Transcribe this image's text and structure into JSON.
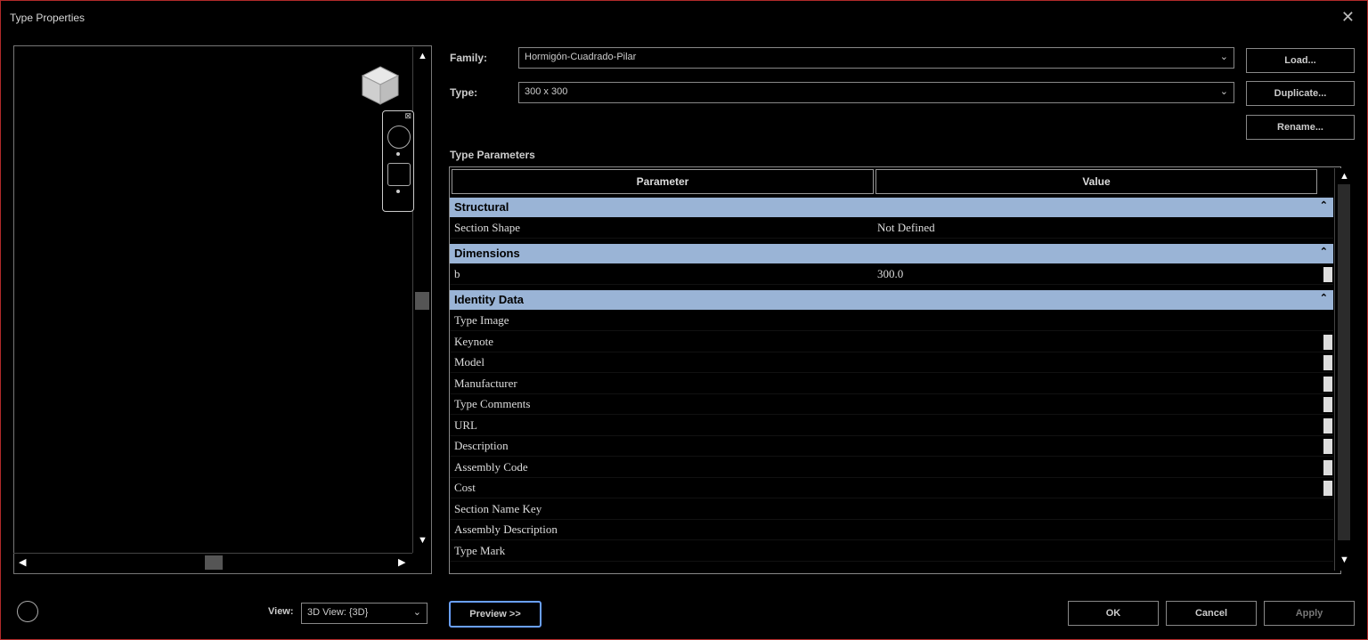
{
  "window": {
    "title": "Type Properties"
  },
  "family": {
    "label": "Family:",
    "value": "Hormigón-Cuadrado-Pilar"
  },
  "type": {
    "label": "Type:",
    "value": "300 x 300"
  },
  "buttons": {
    "load": "Load...",
    "duplicate": "Duplicate...",
    "rename": "Rename...",
    "ok": "OK",
    "cancel": "Cancel",
    "apply": "Apply",
    "preview": "Preview >>"
  },
  "type_parameters": {
    "label": "Type Parameters"
  },
  "grid": {
    "header_parameter": "Parameter",
    "header_value": "Value",
    "groups": [
      {
        "name": "Structural",
        "rows": [
          {
            "param": "Section Shape",
            "value": "Not Defined"
          }
        ]
      },
      {
        "name": "Dimensions",
        "rows": [
          {
            "param": "b",
            "value": "300.0"
          }
        ]
      },
      {
        "name": "Identity Data",
        "rows": [
          {
            "param": "Type Image",
            "value": ""
          },
          {
            "param": "Keynote",
            "value": ""
          },
          {
            "param": "Model",
            "value": ""
          },
          {
            "param": "Manufacturer",
            "value": ""
          },
          {
            "param": "Type Comments",
            "value": ""
          },
          {
            "param": "URL",
            "value": ""
          },
          {
            "param": "Description",
            "value": ""
          },
          {
            "param": "Assembly Code",
            "value": ""
          },
          {
            "param": "Cost",
            "value": ""
          },
          {
            "param": "Section Name Key",
            "value": ""
          },
          {
            "param": "Assembly Description",
            "value": ""
          },
          {
            "param": "Type Mark",
            "value": ""
          }
        ]
      }
    ]
  },
  "view": {
    "label": "View:",
    "value": "3D View: {3D}"
  },
  "colors": {
    "group_header": "#9ab4d6",
    "frame_border": "#b02a2a",
    "preview_focus": "#6aa0ff"
  }
}
